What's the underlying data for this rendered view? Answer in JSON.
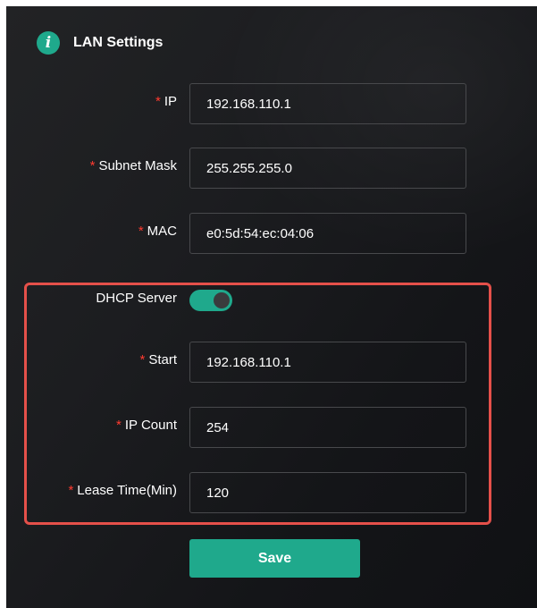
{
  "header": {
    "icon": "info-icon",
    "icon_glyph": "i",
    "title": "LAN Settings"
  },
  "fields": {
    "ip": {
      "required": "*",
      "label": "IP",
      "value": "192.168.110.1"
    },
    "subnet_mask": {
      "required": "*",
      "label": "Subnet Mask",
      "value": "255.255.255.0"
    },
    "mac": {
      "required": "*",
      "label": "MAC",
      "value": "e0:5d:54:ec:04:06"
    }
  },
  "dhcp": {
    "label": "DHCP Server",
    "enabled": true,
    "start": {
      "required": "*",
      "label": "Start",
      "value": "192.168.110.1"
    },
    "ip_count": {
      "required": "*",
      "label": "IP Count",
      "value": "254"
    },
    "lease_time": {
      "required": "*",
      "label": "Lease Time(Min)",
      "value": "120"
    }
  },
  "actions": {
    "save_label": "Save"
  },
  "colors": {
    "accent": "#1fa98c",
    "highlight_border": "#e5504a",
    "required": "#ff3b30",
    "background": "#1c1d20"
  }
}
